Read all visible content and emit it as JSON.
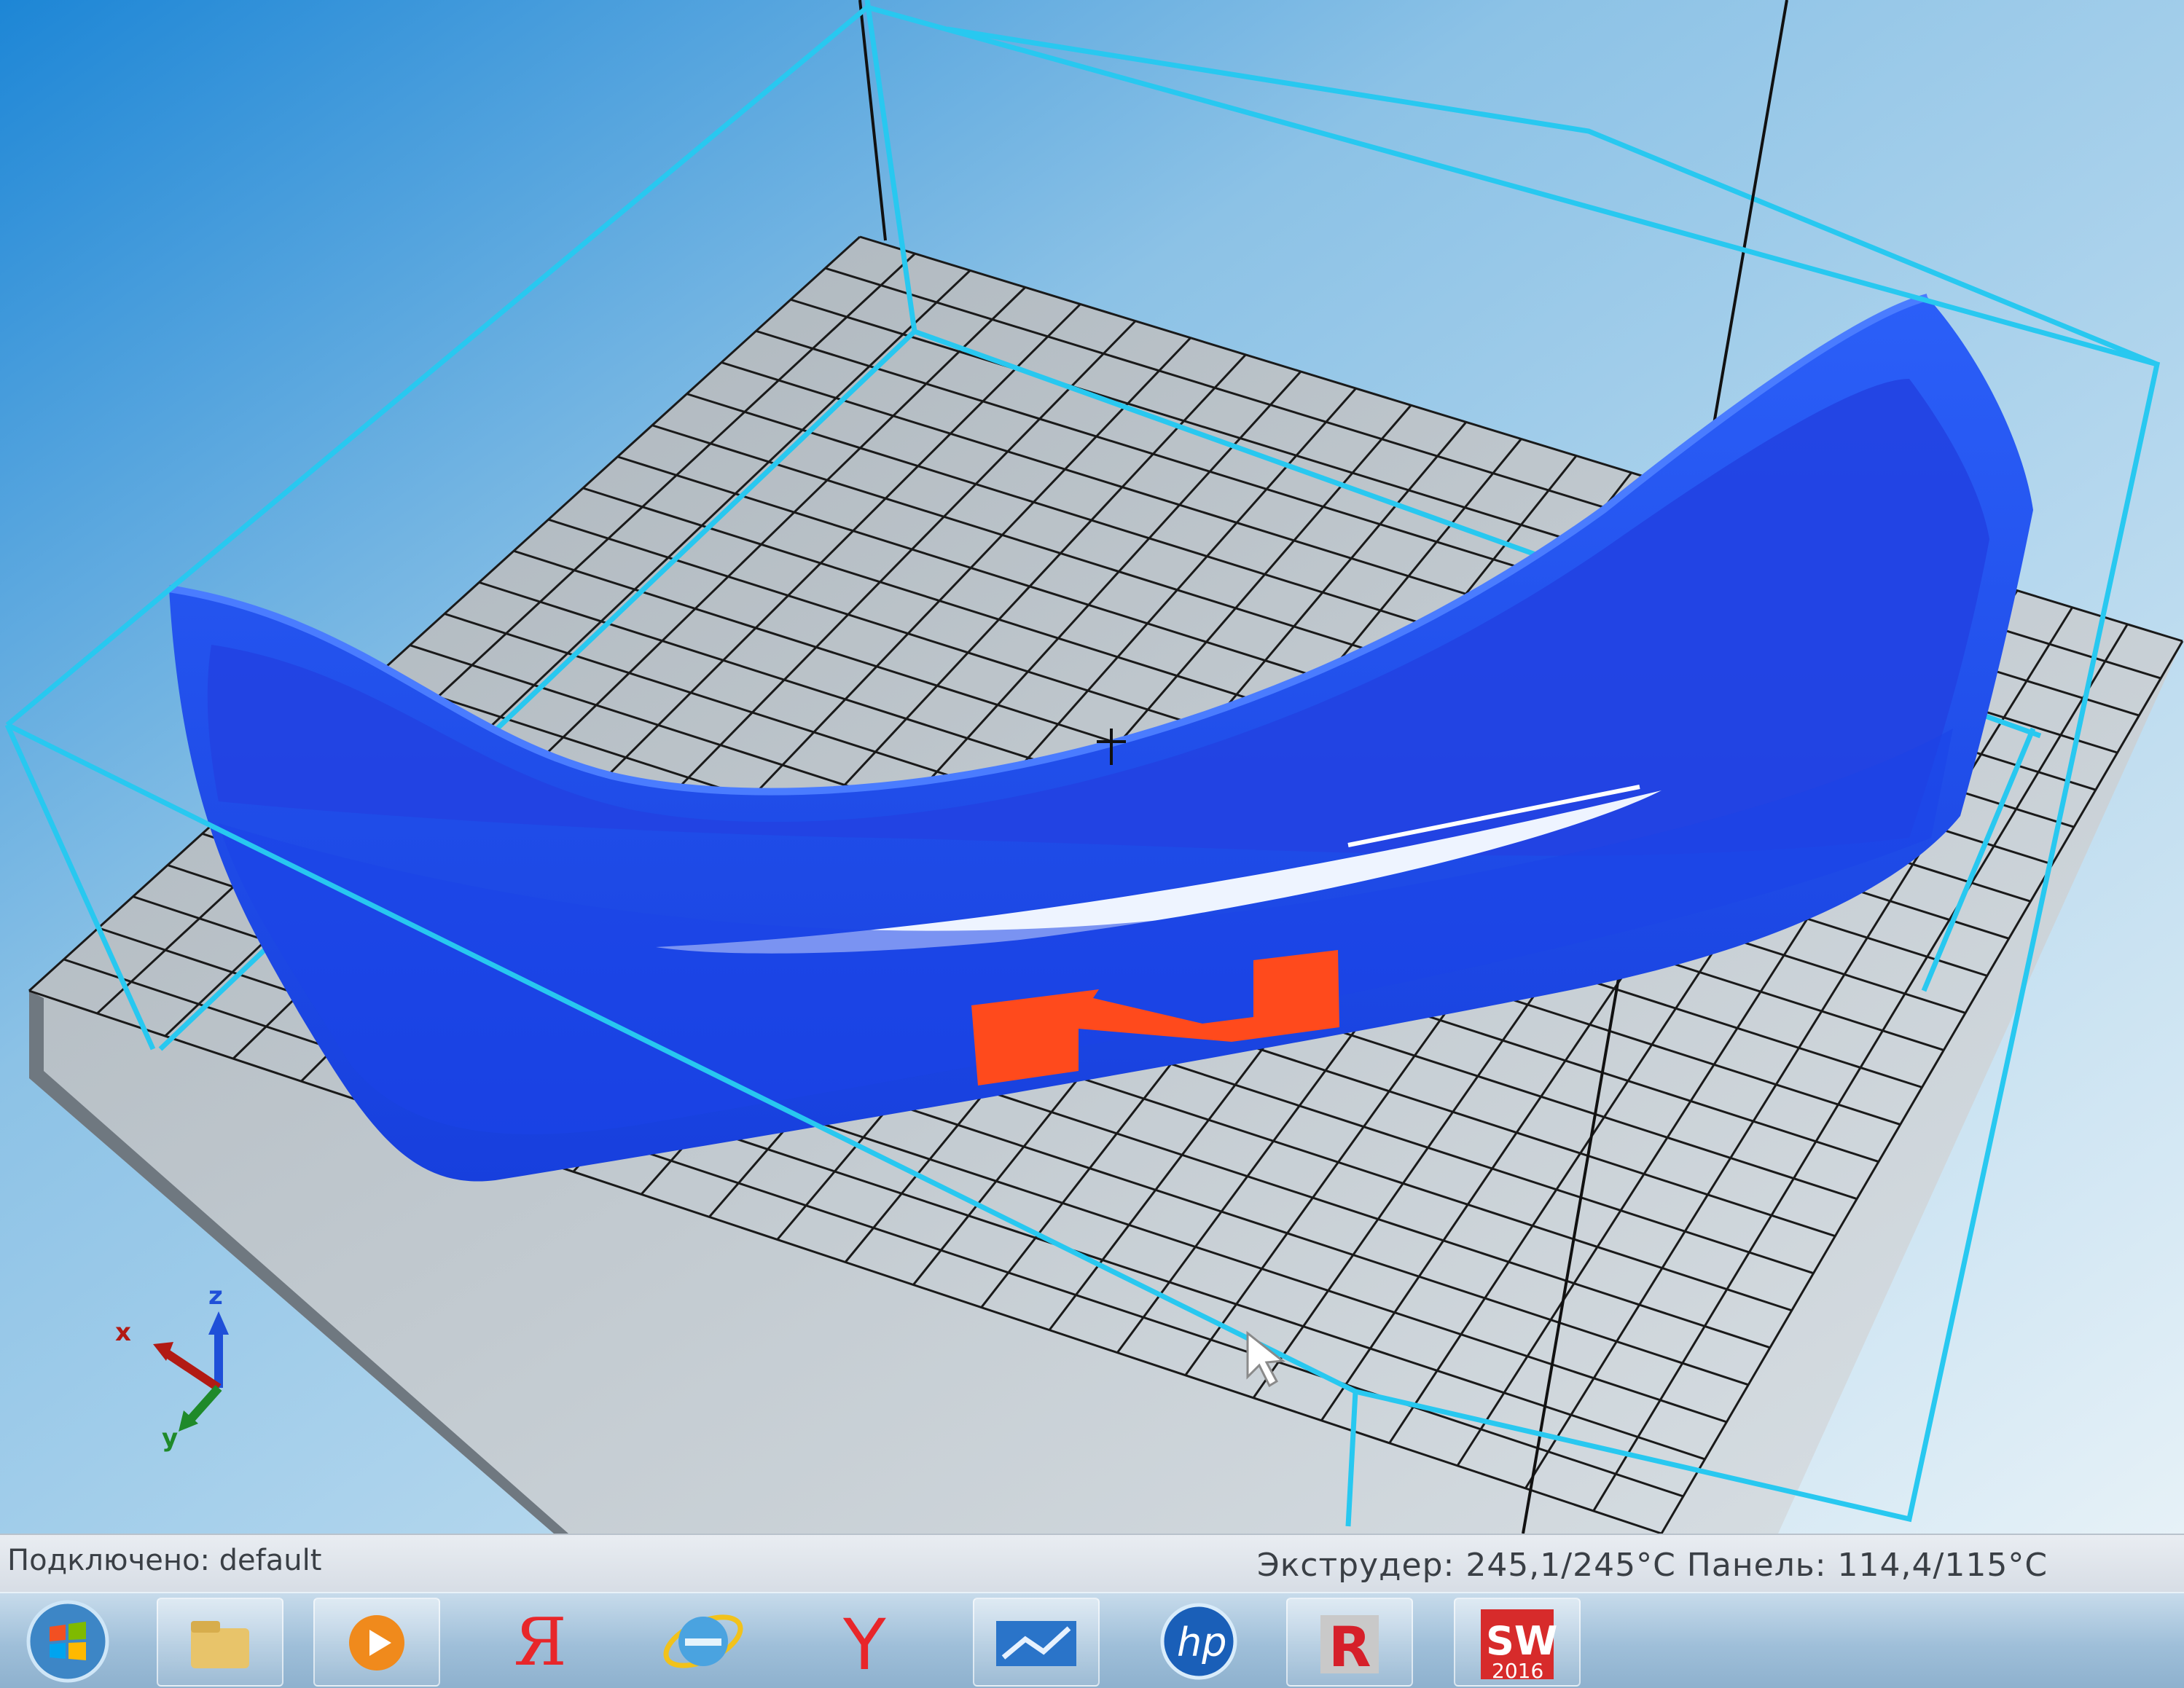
{
  "status": {
    "connection": "Подключено: default",
    "temperatures": "Экструдер: 245,1/245°С Панель: 114,4/115°С"
  },
  "axes": {
    "x_label": "x",
    "y_label": "y",
    "z_label": "z"
  },
  "colors": {
    "bed_grid": "#1a1a1a",
    "build_volume": "#28c8f0",
    "model": "#1f4ff0",
    "model_mark": "#ff4a1c"
  },
  "taskbar": {
    "items": [
      "start-orb-icon",
      "file-explorer-icon",
      "media-player-icon",
      "yandex-icon",
      "internet-explorer-icon",
      "yandex-browser-icon",
      "monitor-app-icon",
      "hp-icon",
      "revit-icon",
      "solidworks-icon"
    ],
    "solidworks_label": "SW",
    "solidworks_year": "2016",
    "revit_label": "R",
    "yandex_label": "Я",
    "yandex_browser_label": "Y",
    "hp_label": "hp"
  }
}
